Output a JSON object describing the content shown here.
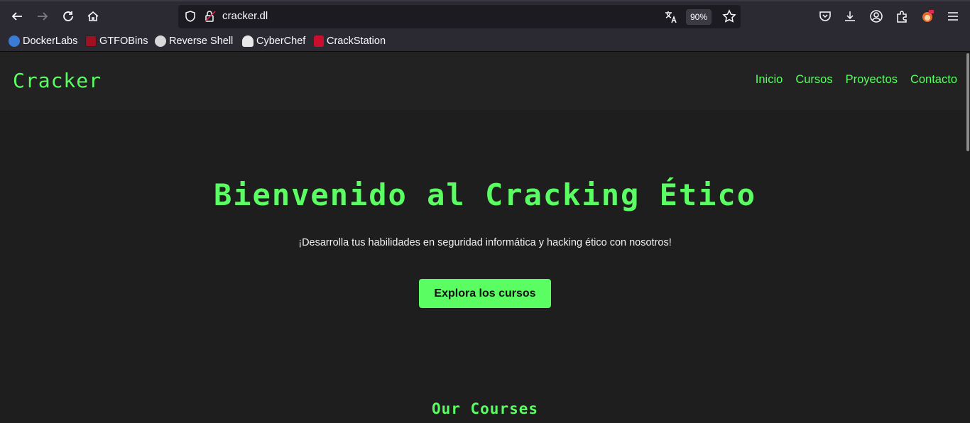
{
  "browser": {
    "url": "cracker.dl",
    "zoom": "90%",
    "bookmarks": [
      "DockerLabs",
      "GTFOBins",
      "Reverse Shell",
      "CyberChef",
      "CrackStation"
    ]
  },
  "site": {
    "logo": "Cracker",
    "nav": [
      "Inicio",
      "Cursos",
      "Proyectos",
      "Contacto"
    ],
    "hero_title": "Bienvenido al Cracking Ético",
    "hero_subtitle": "¡Desarrolla tus habilidades en seguridad informática y hacking ético con nosotros!",
    "cta_label": "Explora los cursos",
    "courses_title": "Our Courses"
  },
  "colors": {
    "accent": "#5afe62",
    "page_bg": "#1e1e1e",
    "header_bg": "#222222"
  }
}
